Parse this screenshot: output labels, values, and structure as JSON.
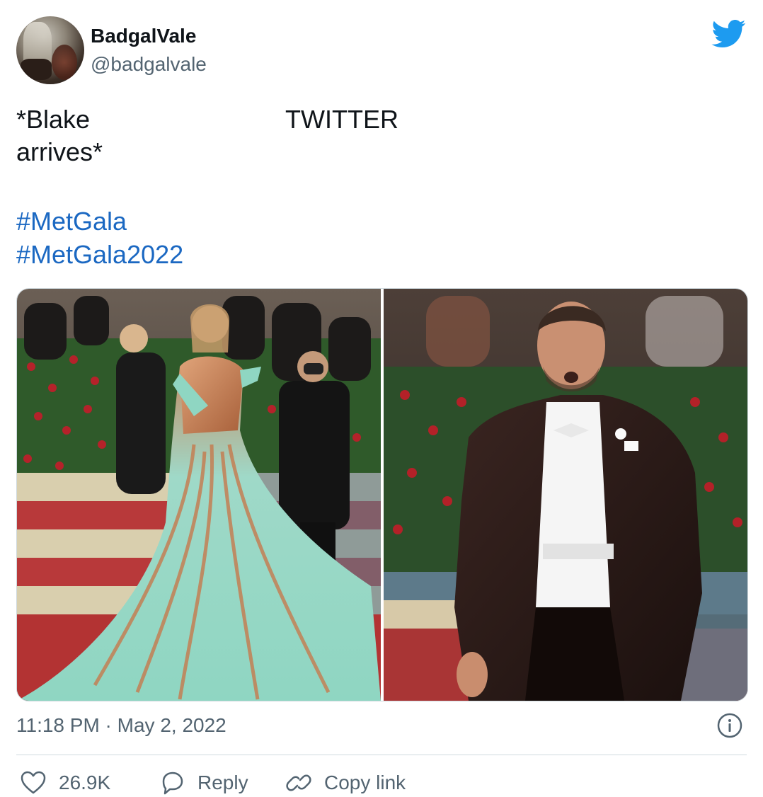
{
  "author": {
    "display_name": "BadgalVale",
    "handle": "@badgalvale"
  },
  "tweet": {
    "text_col1": "*Blake arrives*",
    "text_col2": "TWITTER",
    "hashtags": [
      "#MetGala",
      "#MetGala2022"
    ],
    "timestamp": "11:18 PM · May 2, 2022"
  },
  "media": {
    "images": [
      "left-photo",
      "right-photo"
    ]
  },
  "actions": {
    "like_count": "26.9K",
    "reply_label": "Reply",
    "copy_label": "Copy link"
  },
  "colors": {
    "link": "#1b68c2",
    "twitter_blue": "#1d9bf0",
    "muted": "#536471"
  },
  "icons": {
    "brand": "twitter-bird-icon",
    "info": "info-icon",
    "like": "heart-icon",
    "reply": "speech-bubble-icon",
    "copy": "link-icon"
  }
}
